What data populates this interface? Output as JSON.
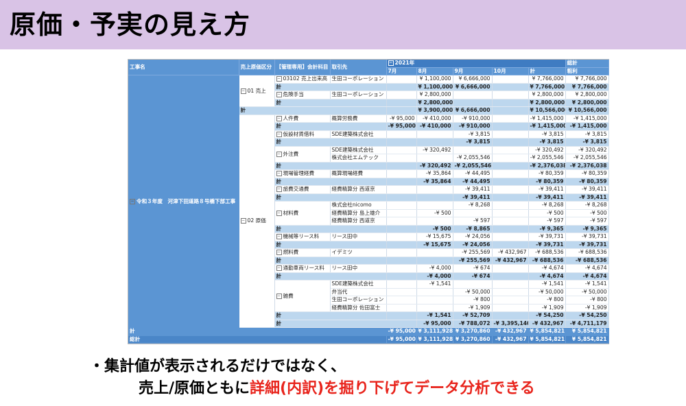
{
  "title": "原価・予実の見え方",
  "bullet1": "・集計値が表示されるだけではなく、",
  "bullet2_black": "売上/原価ともに",
  "bullet2_red": "詳細(内訳)を掘り下げてデータ分析できる",
  "table": {
    "h_koji": "工事名",
    "h_kubun": "売上原価区分",
    "h_kamoku": "【管理専用】会計科目",
    "h_torihiki": "取引先",
    "h_year": "2021年",
    "h_months": [
      "7月",
      "8月",
      "9月",
      "10月",
      "計"
    ],
    "h_sokei": "総計",
    "h_arari": "粗利",
    "project": "令和３年度　河津下田道路８号橋下部工事",
    "k_uri": "01 売上",
    "k_gen": "02 原価",
    "kei": "計",
    "sokei_label": "総計",
    "rows": [
      {
        "t": "d",
        "a": "03102 売上出来高",
        "v": "生田コーポレーション",
        "c": [
          "",
          "¥ 1,100,000",
          "¥ 6,666,000",
          "",
          "¥ 7,766,000",
          "¥ 7,766,000"
        ]
      },
      {
        "t": "s",
        "c": [
          "",
          "¥ 1,100,000",
          "¥ 6,666,000",
          "",
          "¥ 7,766,000",
          "¥ 7,766,000"
        ]
      },
      {
        "t": "d",
        "a": "危険手当",
        "v": "生田コーポレーション",
        "c": [
          "",
          "¥ 2,800,000",
          "",
          "",
          "¥ 2,800,000",
          "¥ 2,800,000"
        ]
      },
      {
        "t": "s",
        "c": [
          "",
          "¥ 2,800,000",
          "",
          "",
          "¥ 2,800,000",
          "¥ 2,800,000"
        ]
      },
      {
        "t": "k",
        "c": [
          "",
          "¥ 3,900,000",
          "¥ 6,666,000",
          "",
          "¥ 10,566,000",
          "¥ 10,566,000"
        ]
      },
      {
        "t": "d",
        "a": "人件費",
        "v": "概算労務費",
        "c": [
          "-¥ 95,000",
          "-¥ 410,000",
          "-¥ 910,000",
          "",
          "-¥ 1,415,000",
          "-¥ 1,415,000"
        ]
      },
      {
        "t": "s",
        "c": [
          "-¥ 95,000",
          "-¥ 410,000",
          "-¥ 910,000",
          "",
          "-¥ 1,415,000",
          "-¥ 1,415,000"
        ]
      },
      {
        "t": "d",
        "a": "仮設材賃借料",
        "v": "SDE建築株式会社",
        "c": [
          "",
          "",
          "-¥ 3,815",
          "",
          "-¥ 3,815",
          "-¥ 3,815"
        ]
      },
      {
        "t": "s",
        "c": [
          "",
          "",
          "-¥ 3,815",
          "",
          "-¥ 3,815",
          "-¥ 3,815"
        ]
      },
      {
        "t": "d",
        "a": "外注費",
        "v": "SDE建築株式会社",
        "c": [
          "",
          "-¥ 320,492",
          "",
          "",
          "-¥ 320,492",
          "-¥ 320,492"
        ]
      },
      {
        "t": "d",
        "a": "",
        "v": "株式会社エムテック",
        "c": [
          "",
          "",
          "-¥ 2,055,546",
          "",
          "-¥ 2,055,546",
          "-¥ 2,055,546"
        ]
      },
      {
        "t": "s",
        "c": [
          "",
          "-¥ 320,492",
          "-¥ 2,055,546",
          "",
          "-¥ 2,376,038",
          "-¥ 2,376,038"
        ]
      },
      {
        "t": "d",
        "a": "現場管理経費",
        "v": "概算現場経費",
        "c": [
          "",
          "-¥ 35,864",
          "-¥ 44,495",
          "",
          "-¥ 80,359",
          "-¥ 80,359"
        ]
      },
      {
        "t": "s",
        "c": [
          "",
          "-¥ 35,864",
          "-¥ 44,495",
          "",
          "-¥ 80,359",
          "-¥ 80,359"
        ]
      },
      {
        "t": "d",
        "a": "旅費交通費",
        "v": "経費精算分 西道京",
        "c": [
          "",
          "",
          "-¥ 39,411",
          "",
          "-¥ 39,411",
          "-¥ 39,411"
        ]
      },
      {
        "t": "s",
        "c": [
          "",
          "",
          "-¥ 39,411",
          "",
          "-¥ 39,411",
          "-¥ 39,411"
        ]
      },
      {
        "t": "d",
        "a": "材料費",
        "v": "株式会社nicomo",
        "c": [
          "",
          "",
          "-¥ 8,268",
          "",
          "-¥ 8,268",
          "-¥ 8,268"
        ]
      },
      {
        "t": "d",
        "a": "",
        "v": "経費精算分 島上雄介",
        "c": [
          "",
          "-¥ 500",
          "",
          "",
          "-¥ 500",
          "-¥ 500"
        ]
      },
      {
        "t": "d",
        "a": "",
        "v": "経費精算分 西道京",
        "c": [
          "",
          "",
          "-¥ 597",
          "",
          "-¥ 597",
          "-¥ 597"
        ]
      },
      {
        "t": "s",
        "c": [
          "",
          "-¥ 500",
          "-¥ 8,865",
          "",
          "-¥ 9,365",
          "-¥ 9,365"
        ]
      },
      {
        "t": "d",
        "a": "機械等リース料",
        "v": "リース田中",
        "c": [
          "",
          "-¥ 15,675",
          "-¥ 24,056",
          "",
          "-¥ 39,731",
          "-¥ 39,731"
        ]
      },
      {
        "t": "s",
        "c": [
          "",
          "-¥ 15,675",
          "-¥ 24,056",
          "",
          "-¥ 39,731",
          "-¥ 39,731"
        ]
      },
      {
        "t": "d",
        "a": "燃料費",
        "v": "イデミツ",
        "c": [
          "",
          "",
          "-¥ 255,569",
          "-¥ 432,967",
          "-¥ 688,536",
          "-¥ 688,536"
        ]
      },
      {
        "t": "s",
        "c": [
          "",
          "",
          "-¥ 255,569",
          "-¥ 432,967",
          "-¥ 688,536",
          "-¥ 688,536"
        ]
      },
      {
        "t": "d",
        "a": "通勤車両リース料",
        "v": "リース田中",
        "c": [
          "",
          "-¥ 4,000",
          "-¥ 674",
          "",
          "-¥ 4,674",
          "-¥ 4,674"
        ]
      },
      {
        "t": "s",
        "c": [
          "",
          "-¥ 4,000",
          "-¥ 674",
          "",
          "-¥ 4,674",
          "-¥ 4,674"
        ]
      },
      {
        "t": "d",
        "a": "雑費",
        "v": "SDE建築株式会社",
        "c": [
          "",
          "-¥ 1,541",
          "",
          "",
          "-¥ 1,541",
          "-¥ 1,541"
        ]
      },
      {
        "t": "d",
        "a": "",
        "v": "弁当代",
        "c": [
          "",
          "",
          "-¥ 50,000",
          "",
          "-¥ 50,000",
          "-¥ 50,000"
        ]
      },
      {
        "t": "d",
        "a": "",
        "v": "生田コーポレーション",
        "c": [
          "",
          "",
          "-¥ 800",
          "",
          "-¥ 800",
          "-¥ 800"
        ]
      },
      {
        "t": "d",
        "a": "",
        "v": "経費精算分 佐田富士",
        "c": [
          "",
          "",
          "-¥ 1,909",
          "",
          "-¥ 1,909",
          "-¥ 1,909"
        ]
      },
      {
        "t": "s",
        "c": [
          "",
          "-¥ 1,541",
          "-¥ 52,709",
          "",
          "-¥ 54,250",
          "-¥ 54,250"
        ]
      },
      {
        "t": "k",
        "c": [
          "-¥ 95,000",
          "-¥ 788,072",
          "-¥ 3,395,140",
          "-¥ 432,967",
          "-¥ 4,711,179",
          "-¥ 4,711,179"
        ]
      },
      {
        "t": "pk",
        "c": [
          "-¥ 95,000",
          "¥ 3,111,928",
          "¥ 3,270,860",
          "-¥ 432,967",
          "¥ 5,854,821",
          "¥ 5,854,821"
        ]
      },
      {
        "t": "g",
        "c": [
          "-¥ 95,000",
          "¥ 3,111,928",
          "¥ 3,270,860",
          "-¥ 432,967",
          "¥ 5,854,821",
          "¥ 5,854,821"
        ]
      }
    ]
  }
}
